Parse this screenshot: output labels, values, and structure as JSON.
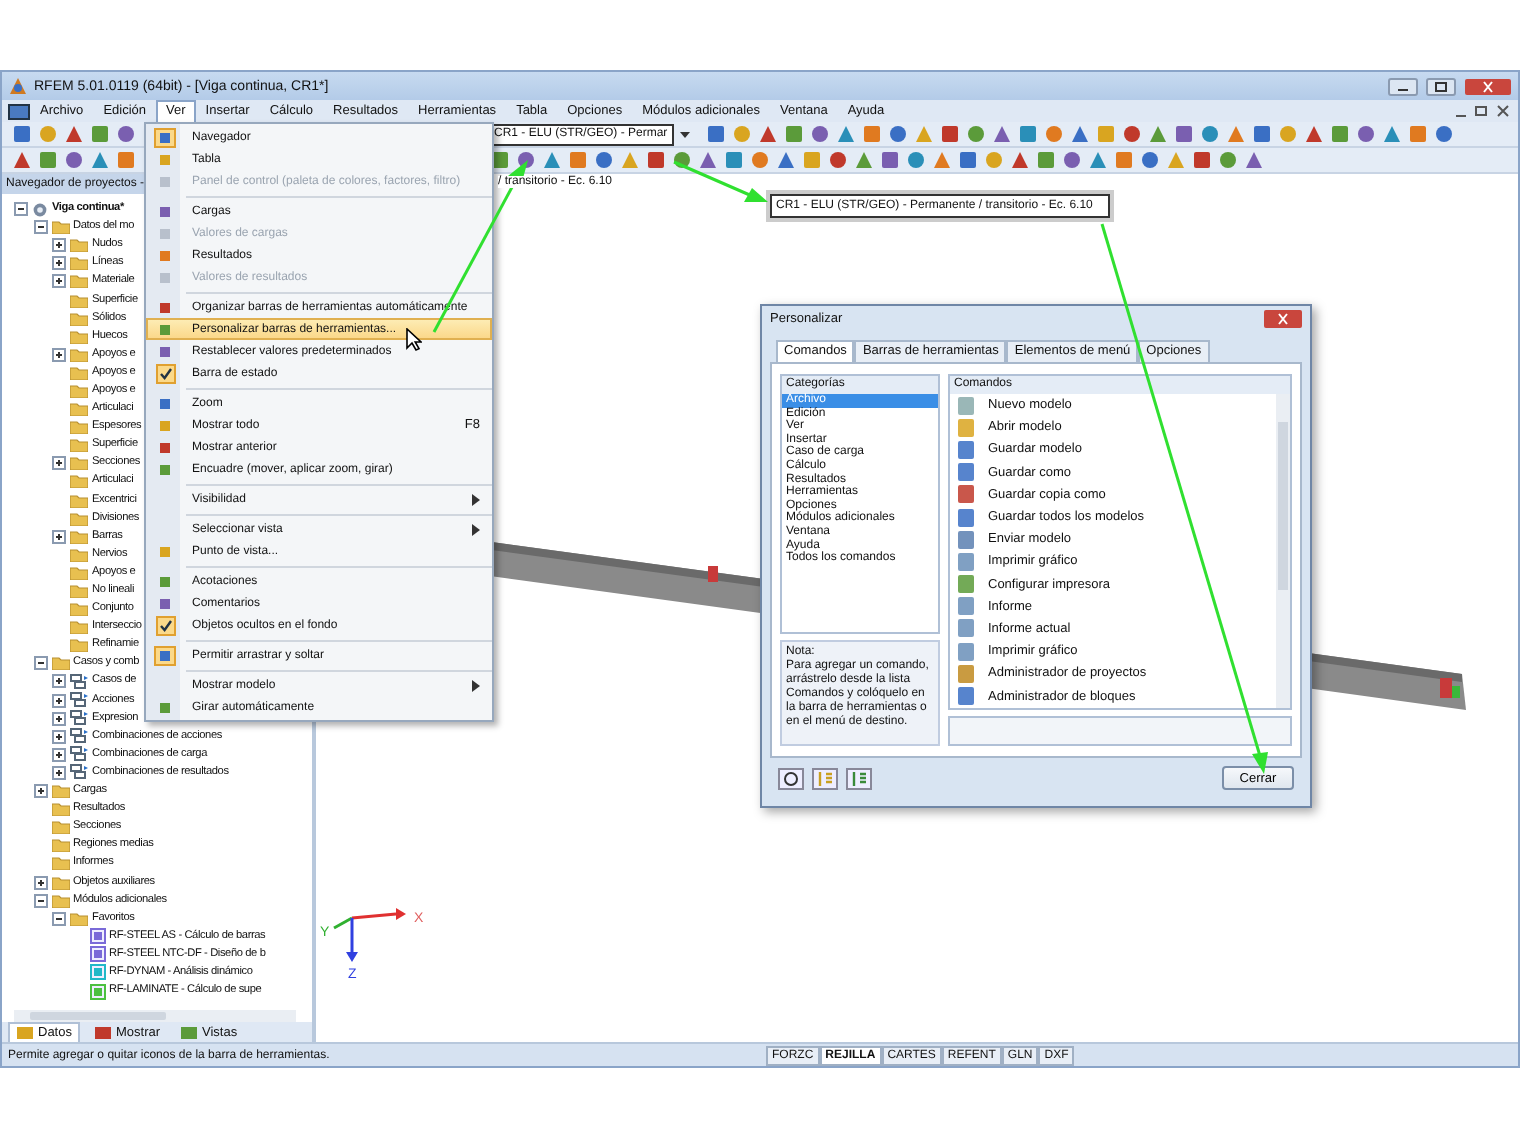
{
  "window": {
    "title": "RFEM 5.01.0119 (64bit) - [Viga continua, CR1*]"
  },
  "menubar": [
    {
      "label": "Archivo",
      "selected": false
    },
    {
      "label": "Edición",
      "selected": false
    },
    {
      "label": "Ver",
      "selected": true
    },
    {
      "label": "Insertar",
      "selected": false
    },
    {
      "label": "Cálculo",
      "selected": false
    },
    {
      "label": "Resultados",
      "selected": false
    },
    {
      "label": "Herramientas",
      "selected": false
    },
    {
      "label": "Tabla",
      "selected": false
    },
    {
      "label": "Opciones",
      "selected": false
    },
    {
      "label": "Módulos adicionales",
      "selected": false
    },
    {
      "label": "Ventana",
      "selected": false
    },
    {
      "label": "Ayuda",
      "selected": false
    }
  ],
  "toolbar": {
    "load_case": "CR1 - ELU (STR/GEO) - Permar"
  },
  "view_menu": [
    {
      "kind": "item",
      "label": "Navegador",
      "checked": true,
      "disabled": false,
      "selected": false
    },
    {
      "kind": "item",
      "label": "Tabla",
      "checked": false,
      "disabled": false,
      "selected": false
    },
    {
      "kind": "item",
      "label": "Panel de control (paleta de colores, factores, filtro)",
      "checked": false,
      "disabled": true,
      "selected": false
    },
    {
      "kind": "separator"
    },
    {
      "kind": "item",
      "label": "Cargas",
      "checked": false,
      "disabled": false,
      "selected": false
    },
    {
      "kind": "item",
      "label": "Valores de cargas",
      "checked": false,
      "disabled": true,
      "selected": false
    },
    {
      "kind": "item",
      "label": "Resultados",
      "checked": false,
      "disabled": false,
      "selected": false
    },
    {
      "kind": "item",
      "label": "Valores de resultados",
      "checked": false,
      "disabled": true,
      "selected": false
    },
    {
      "kind": "separator"
    },
    {
      "kind": "item",
      "label": "Organizar barras de herramientas automáticamente",
      "checked": false,
      "disabled": false,
      "selected": false
    },
    {
      "kind": "item",
      "label": "Personalizar barras de herramientas...",
      "checked": false,
      "disabled": false,
      "selected": true
    },
    {
      "kind": "item",
      "label": "Restablecer valores predeterminados",
      "checked": false,
      "disabled": false,
      "selected": false
    },
    {
      "kind": "check",
      "label": "Barra de estado",
      "checked": true,
      "disabled": false,
      "selected": false
    },
    {
      "kind": "separator"
    },
    {
      "kind": "item",
      "label": "Zoom",
      "checked": false,
      "disabled": false,
      "selected": false
    },
    {
      "kind": "item",
      "label": "Mostrar todo",
      "shortcut": "F8",
      "checked": false,
      "disabled": false,
      "selected": false
    },
    {
      "kind": "item",
      "label": "Mostrar anterior",
      "checked": false,
      "disabled": false,
      "selected": false
    },
    {
      "kind": "item",
      "label": "Encuadre (mover, aplicar zoom, girar)",
      "checked": false,
      "disabled": false,
      "selected": false
    },
    {
      "kind": "separator"
    },
    {
      "kind": "submenu",
      "label": "Visibilidad",
      "disabled": false,
      "selected": false
    },
    {
      "kind": "separator"
    },
    {
      "kind": "submenu",
      "label": "Seleccionar vista",
      "disabled": false,
      "selected": false
    },
    {
      "kind": "item",
      "label": "Punto de vista...",
      "checked": false,
      "disabled": false,
      "selected": false
    },
    {
      "kind": "separator"
    },
    {
      "kind": "item",
      "label": "Acotaciones",
      "checked": false,
      "disabled": false,
      "selected": false
    },
    {
      "kind": "item",
      "label": "Comentarios",
      "checked": false,
      "disabled": false,
      "selected": false
    },
    {
      "kind": "check",
      "label": "Objetos ocultos en el fondo",
      "checked": true,
      "disabled": false,
      "selected": false
    },
    {
      "kind": "separator"
    },
    {
      "kind": "item",
      "label": "Permitir arrastrar y soltar",
      "checked": true,
      "disabled": false,
      "selected": false
    },
    {
      "kind": "separator"
    },
    {
      "kind": "submenu",
      "label": "Mostrar modelo",
      "disabled": false,
      "selected": false
    },
    {
      "kind": "item",
      "label": "Girar automáticamente",
      "checked": false,
      "disabled": false,
      "selected": false
    }
  ],
  "sidebar": {
    "title": "Navegador de proyectos -",
    "tree": [
      {
        "label": "Viga continua*",
        "kind": "model",
        "expanded": true,
        "children": [
          {
            "label": "Datos del mo",
            "kind": "folder",
            "expanded": true,
            "children": [
              {
                "label": "Nudos",
                "kind": "folder",
                "expanded": false
              },
              {
                "label": "Líneas",
                "kind": "folder",
                "expanded": false
              },
              {
                "label": "Materiale",
                "kind": "folder",
                "expanded": false
              },
              {
                "label": "Superficie",
                "kind": "folder"
              },
              {
                "label": "Sólidos",
                "kind": "folder"
              },
              {
                "label": "Huecos",
                "kind": "folder"
              },
              {
                "label": "Apoyos e",
                "kind": "folder",
                "expanded": false
              },
              {
                "label": "Apoyos e",
                "kind": "folder"
              },
              {
                "label": "Apoyos e",
                "kind": "folder"
              },
              {
                "label": "Articulaci",
                "kind": "folder"
              },
              {
                "label": "Espesores",
                "kind": "folder"
              },
              {
                "label": "Superficie",
                "kind": "folder"
              },
              {
                "label": "Secciones",
                "kind": "folder",
                "expanded": false
              },
              {
                "label": "Articulaci",
                "kind": "folder"
              },
              {
                "label": "Excentrici",
                "kind": "folder"
              },
              {
                "label": "Divisiones",
                "kind": "folder"
              },
              {
                "label": "Barras",
                "kind": "folder",
                "expanded": false
              },
              {
                "label": "Nervios",
                "kind": "folder"
              },
              {
                "label": "Apoyos e",
                "kind": "folder"
              },
              {
                "label": "No lineali",
                "kind": "folder"
              },
              {
                "label": "Conjunto",
                "kind": "folder"
              },
              {
                "label": "Interseccio",
                "kind": "folder"
              },
              {
                "label": "Refinamie",
                "kind": "folder"
              }
            ]
          },
          {
            "label": "Casos y comb",
            "kind": "folder",
            "expanded": true,
            "children": [
              {
                "label": "Casos de",
                "kind": "combination",
                "expanded": false
              },
              {
                "label": "Acciones",
                "kind": "combination",
                "expanded": false
              },
              {
                "label": "Expresion",
                "kind": "combination",
                "expanded": false
              },
              {
                "label": "Combinaciones de acciones",
                "kind": "combination",
                "expanded": false
              },
              {
                "label": "Combinaciones de carga",
                "kind": "combination",
                "expanded": false
              },
              {
                "label": "Combinaciones de resultados",
                "kind": "combination",
                "expanded": false
              }
            ]
          },
          {
            "label": "Cargas",
            "kind": "folder",
            "expanded": false
          },
          {
            "label": "Resultados",
            "kind": "folder"
          },
          {
            "label": "Secciones",
            "kind": "folder"
          },
          {
            "label": "Regiones medias",
            "kind": "folder"
          },
          {
            "label": "Informes",
            "kind": "folder"
          },
          {
            "label": "Objetos auxiliares",
            "kind": "folder",
            "expanded": false
          },
          {
            "label": "Módulos adicionales",
            "kind": "folder",
            "expanded": true,
            "children": [
              {
                "label": "Favoritos",
                "kind": "folder",
                "expanded": true,
                "children": [
                  {
                    "label": "RF-STEEL AS - Cálculo de barras",
                    "kind": "module",
                    "color": "#7a6ad8"
                  },
                  {
                    "label": "RF-STEEL NTC-DF - Diseño de b",
                    "kind": "module",
                    "color": "#7a6ad8"
                  },
                  {
                    "label": "RF-DYNAM - Análisis dinámico",
                    "kind": "module",
                    "color": "#20b8c8"
                  },
                  {
                    "label": "RF-LAMINATE - Cálculo de supe",
                    "kind": "module",
                    "color": "#4cc040"
                  }
                ]
              }
            ]
          }
        ]
      }
    ],
    "tabs": [
      {
        "label": "Datos",
        "selected": true
      },
      {
        "label": "Mostrar",
        "selected": false
      },
      {
        "label": "Vistas",
        "selected": false
      }
    ]
  },
  "viewport": {
    "header": "/ transitorio - Ec. 6.10",
    "load_case_callout": "CR1 - ELU (STR/GEO) - Permanente / transitorio - Ec. 6.10",
    "axes": [
      "Y",
      "X",
      "Z"
    ]
  },
  "dialog": {
    "title": "Personalizar",
    "tabs": [
      {
        "label": "Comandos",
        "selected": true
      },
      {
        "label": "Barras de herramientas",
        "selected": false
      },
      {
        "label": "Elementos de menú",
        "selected": false
      },
      {
        "label": "Opciones",
        "selected": false
      }
    ],
    "categories_title": "Categorías",
    "categories": [
      {
        "label": "Archivo",
        "selected": true
      },
      {
        "label": "Edición",
        "selected": false
      },
      {
        "label": "Ver",
        "selected": false
      },
      {
        "label": "Insertar",
        "selected": false
      },
      {
        "label": "Caso de carga",
        "selected": false
      },
      {
        "label": "Cálculo",
        "selected": false
      },
      {
        "label": "Resultados",
        "selected": false
      },
      {
        "label": "Herramientas",
        "selected": false
      },
      {
        "label": "Opciones",
        "selected": false
      },
      {
        "label": "Módulos adicionales",
        "selected": false
      },
      {
        "label": "Ventana",
        "selected": false
      },
      {
        "label": "Ayuda",
        "selected": false
      },
      {
        "label": "Todos los comandos",
        "selected": false
      }
    ],
    "note_title": "Nota:",
    "note": "Para agregar un comando, arrástrelo desde la lista Comandos y colóquelo en la barra de herramientas o en el menú de destino.",
    "commands_title": "Comandos",
    "commands": [
      "Nuevo modelo",
      "Abrir modelo",
      "Guardar modelo",
      "Guardar como",
      "Guardar copia como",
      "Guardar todos los modelos",
      "Enviar modelo",
      "Imprimir gráfico",
      "Configurar impresora",
      "Informe",
      "Informe actual",
      "Imprimir gráfico",
      "Administrador de proyectos",
      "Administrador de bloques"
    ],
    "close": "Cerrar"
  },
  "status_bar": {
    "text": "Permite agregar o quitar iconos de la barra de herramientas.",
    "toggles": [
      {
        "label": "FORZC",
        "on": false
      },
      {
        "label": "REJILLA",
        "on": true
      },
      {
        "label": "CARTES",
        "on": false
      },
      {
        "label": "REFENT",
        "on": false
      },
      {
        "label": "GLN",
        "on": false
      },
      {
        "label": "DXF",
        "on": false
      }
    ]
  }
}
